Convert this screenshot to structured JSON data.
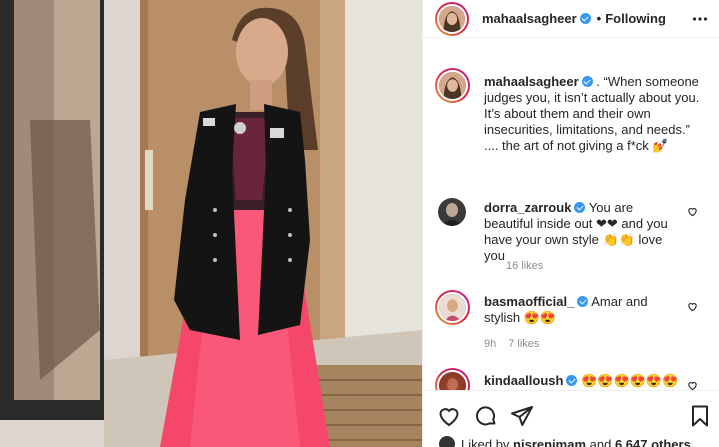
{
  "post": {
    "username": "mahaalsagheer",
    "separator": "•",
    "follow_state": "Following"
  },
  "caption": {
    "username": "mahaalsagheer",
    "text": ". “When someone judges you, it isn’t actually about you. It’s about them and their own insecurities, limitations, and needs.” .... the art of not giving a f*ck 💅"
  },
  "comments": [
    {
      "username": "dorra_zarrouk",
      "text": "You are beautiful inside out ❤❤ and you have your own style 👏👏 love you",
      "likes": "16 likes",
      "age": ""
    },
    {
      "username": "basmaofficial_",
      "text": "Amar and stylish 😍😍",
      "likes": "7 likes",
      "age": "9h"
    },
    {
      "username": "kindaalloush",
      "text": "😍😍😍😍😍😍😍😍",
      "likes": "",
      "age": ""
    }
  ],
  "likes_line": {
    "prefix": "Liked by ",
    "user": "nisrenimam",
    "middle": " and ",
    "count": "6,647 others"
  },
  "icons": {
    "more": "more-horizontal-icon",
    "like": "heart-icon",
    "comment": "comment-bubble-icon",
    "share": "paper-plane-icon",
    "save": "bookmark-icon",
    "verified": "verified-badge-icon"
  },
  "colors": {
    "verified": "#3897f0",
    "text": "#262626",
    "meta": "#8e8e8e",
    "dress": "#f5476a",
    "jacket": "#141414"
  }
}
